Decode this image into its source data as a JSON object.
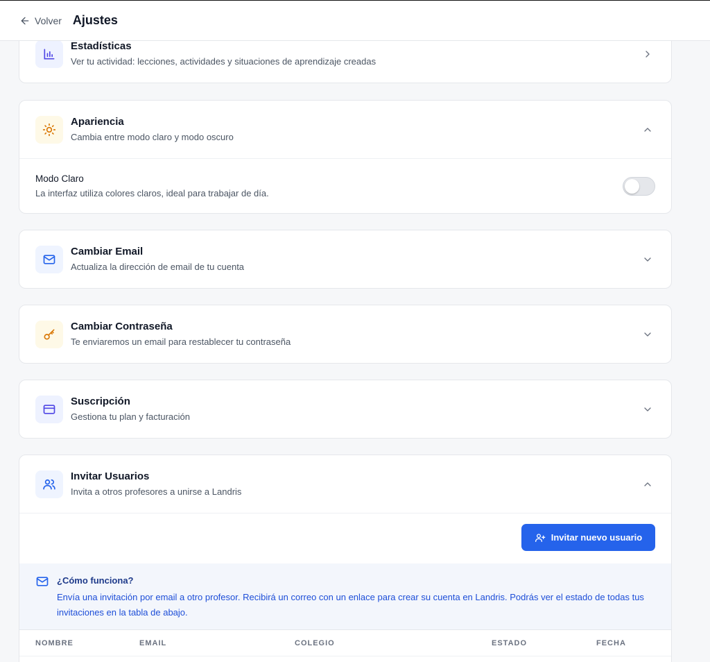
{
  "header": {
    "back_label": "Volver",
    "title": "Ajustes"
  },
  "sections": {
    "stats": {
      "title": "Estadísticas",
      "desc": "Ver tu actividad: lecciones, actividades y situaciones de aprendizaje creadas"
    },
    "appearance": {
      "title": "Apariencia",
      "desc": "Cambia entre modo claro y modo oscuro",
      "mode_title": "Modo Claro",
      "mode_desc": "La interfaz utiliza colores claros, ideal para trabajar de día.",
      "dark_mode_on": false
    },
    "email": {
      "title": "Cambiar Email",
      "desc": "Actualiza la dirección de email de tu cuenta"
    },
    "password": {
      "title": "Cambiar Contraseña",
      "desc": "Te enviaremos un email para restablecer tu contraseña"
    },
    "subscription": {
      "title": "Suscripción",
      "desc": "Gestiona tu plan y facturación"
    },
    "invite": {
      "title": "Invitar Usuarios",
      "desc": "Invita a otros profesores a unirse a Landris",
      "button_label": "Invitar nuevo usuario",
      "info_title": "¿Cómo funciona?",
      "info_body": "Envía una invitación por email a otro profesor. Recibirá un correo con un enlace para crear su cuenta en Landris. Podrás ver el estado de todas tus invitaciones en la tabla de abajo.",
      "columns": [
        "Nombre",
        "Email",
        "Colegio",
        "Estado",
        "Fecha"
      ]
    }
  },
  "colors": {
    "accent": "#2563eb",
    "stats_icon_bg": "#eef2ff",
    "stats_icon": "#4f46e5",
    "appearance_icon_bg": "#fef9e7",
    "appearance_icon": "#d97706",
    "email_icon_bg": "#eff4ff",
    "email_icon": "#2563eb",
    "password_icon_bg": "#fef9e7",
    "password_icon": "#d97706",
    "subscription_icon_bg": "#eef2ff",
    "subscription_icon": "#4f46e5",
    "invite_icon_bg": "#eff4ff",
    "invite_icon": "#2563eb"
  }
}
